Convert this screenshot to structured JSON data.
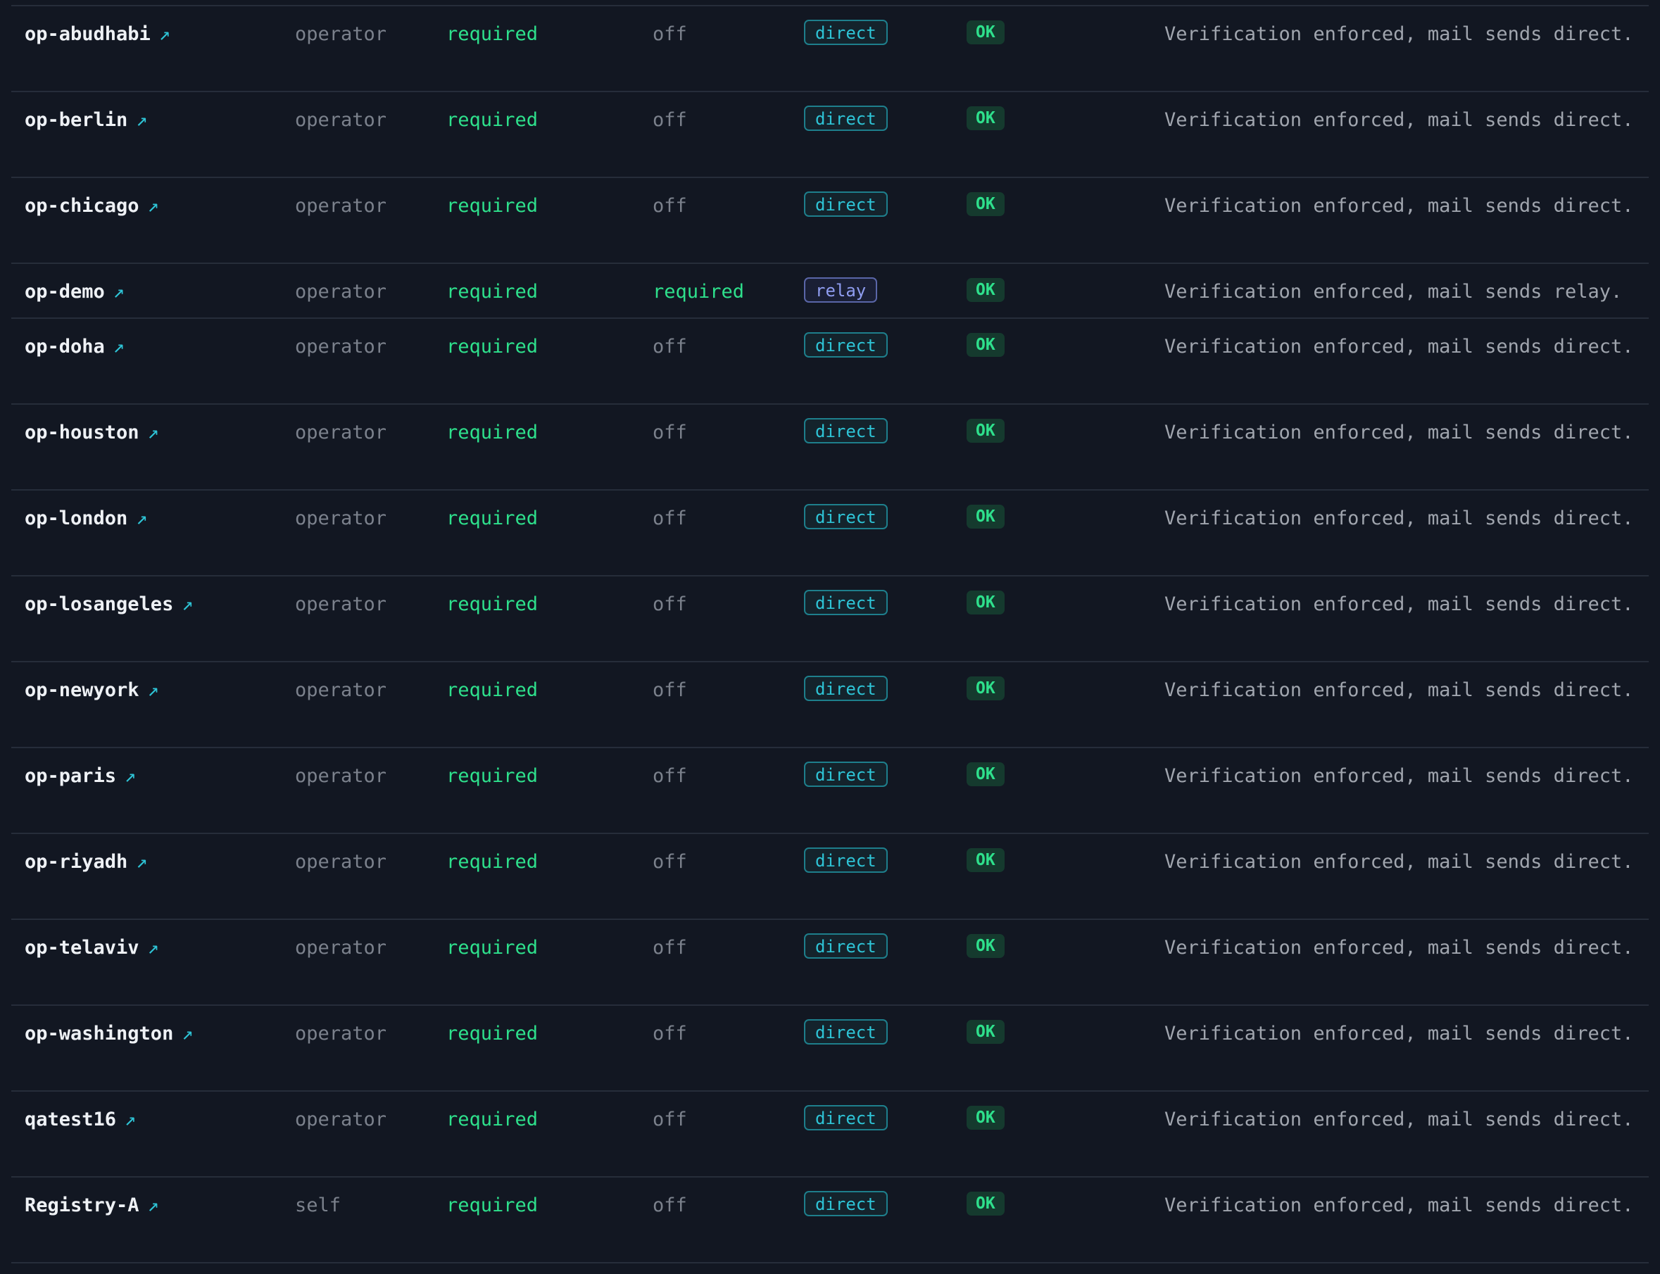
{
  "table": {
    "rows": [
      {
        "name": "op-abudhabi",
        "link_glyph": "↗",
        "scope": "operator",
        "verification": "required",
        "relay": "off",
        "mode": "direct",
        "status": "OK",
        "note": "Verification enforced, mail sends direct."
      },
      {
        "name": "op-berlin",
        "link_glyph": "↗",
        "scope": "operator",
        "verification": "required",
        "relay": "off",
        "mode": "direct",
        "status": "OK",
        "note": "Verification enforced, mail sends direct."
      },
      {
        "name": "op-chicago",
        "link_glyph": "↗",
        "scope": "operator",
        "verification": "required",
        "relay": "off",
        "mode": "direct",
        "status": "OK",
        "note": "Verification enforced, mail sends direct."
      },
      {
        "name": "op-demo",
        "link_glyph": "↗",
        "scope": "operator",
        "verification": "required",
        "relay": "required",
        "mode": "relay",
        "status": "OK",
        "note": "Verification enforced, mail sends relay."
      },
      {
        "name": "op-doha",
        "link_glyph": "↗",
        "scope": "operator",
        "verification": "required",
        "relay": "off",
        "mode": "direct",
        "status": "OK",
        "note": "Verification enforced, mail sends direct."
      },
      {
        "name": "op-houston",
        "link_glyph": "↗",
        "scope": "operator",
        "verification": "required",
        "relay": "off",
        "mode": "direct",
        "status": "OK",
        "note": "Verification enforced, mail sends direct."
      },
      {
        "name": "op-london",
        "link_glyph": "↗",
        "scope": "operator",
        "verification": "required",
        "relay": "off",
        "mode": "direct",
        "status": "OK",
        "note": "Verification enforced, mail sends direct."
      },
      {
        "name": "op-losangeles",
        "link_glyph": "↗",
        "scope": "operator",
        "verification": "required",
        "relay": "off",
        "mode": "direct",
        "status": "OK",
        "note": "Verification enforced, mail sends direct."
      },
      {
        "name": "op-newyork",
        "link_glyph": "↗",
        "scope": "operator",
        "verification": "required",
        "relay": "off",
        "mode": "direct",
        "status": "OK",
        "note": "Verification enforced, mail sends direct."
      },
      {
        "name": "op-paris",
        "link_glyph": "↗",
        "scope": "operator",
        "verification": "required",
        "relay": "off",
        "mode": "direct",
        "status": "OK",
        "note": "Verification enforced, mail sends direct."
      },
      {
        "name": "op-riyadh",
        "link_glyph": "↗",
        "scope": "operator",
        "verification": "required",
        "relay": "off",
        "mode": "direct",
        "status": "OK",
        "note": "Verification enforced, mail sends direct."
      },
      {
        "name": "op-telaviv",
        "link_glyph": "↗",
        "scope": "operator",
        "verification": "required",
        "relay": "off",
        "mode": "direct",
        "status": "OK",
        "note": "Verification enforced, mail sends direct."
      },
      {
        "name": "op-washington",
        "link_glyph": "↗",
        "scope": "operator",
        "verification": "required",
        "relay": "off",
        "mode": "direct",
        "status": "OK",
        "note": "Verification enforced, mail sends direct."
      },
      {
        "name": "qatest16",
        "link_glyph": "↗",
        "scope": "operator",
        "verification": "required",
        "relay": "off",
        "mode": "direct",
        "status": "OK",
        "note": "Verification enforced, mail sends direct."
      },
      {
        "name": "Registry-A",
        "link_glyph": "↗",
        "scope": "self",
        "verification": "required",
        "relay": "off",
        "mode": "direct",
        "status": "OK",
        "note": "Verification enforced, mail sends direct."
      }
    ]
  },
  "colors": {
    "background": "#121722",
    "divider": "#262d3a",
    "required": "#2ee08c",
    "direct": "#2ec4d6",
    "relay": "#8f9df0",
    "ok_badge_bg": "#153a2e"
  }
}
